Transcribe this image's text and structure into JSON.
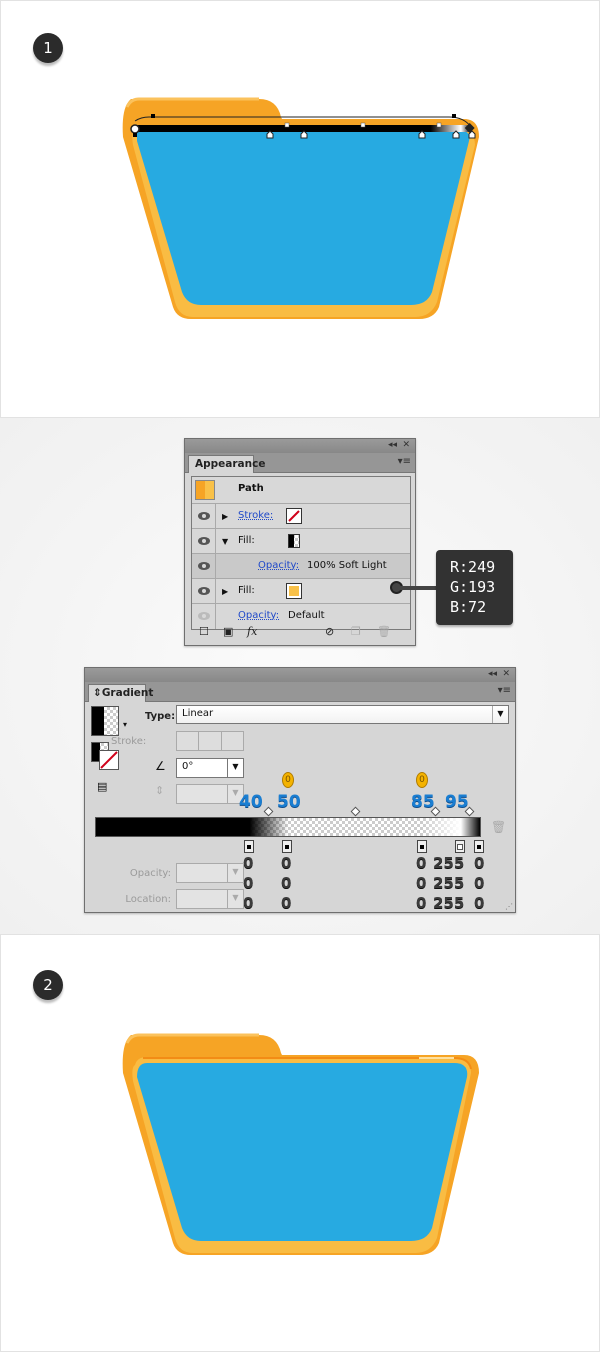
{
  "steps": [
    {
      "number": "1"
    },
    {
      "number": "2"
    }
  ],
  "appearance_panel": {
    "tab_label": "Appearance",
    "collapse_icon": "double-chevron-left-icon",
    "close_icon": "close-icon",
    "menu_icon": "panel-menu-icon",
    "object_label": "Path",
    "rows": [
      {
        "visible": true,
        "expanded": false,
        "label": "Stroke:",
        "swatch": "none"
      },
      {
        "visible": true,
        "expanded": true,
        "label": "Fill:",
        "swatch": "gradient"
      },
      {
        "visible": true,
        "label": "Opacity:",
        "value": "100% Soft Light"
      },
      {
        "visible": true,
        "expanded": false,
        "label": "Fill:",
        "swatch": "#F9C148"
      },
      {
        "visible": false,
        "label": "Opacity:",
        "value": "Default"
      }
    ],
    "footer_icons": [
      "add-new-stroke-icon",
      "add-new-fill-icon",
      "fx-icon",
      "clear-appearance-icon",
      "duplicate-item-icon",
      "delete-item-icon"
    ],
    "fx_label": "fx"
  },
  "color_tooltip": {
    "r": "R:249",
    "g": "G:193",
    "b": "B:72"
  },
  "gradient_panel": {
    "tab_label": "Gradient",
    "type_label": "Type:",
    "type_value": "Linear",
    "stroke_label": "Stroke:",
    "angle_value": "0°",
    "opacity_label": "Opacity:",
    "location_label": "Location:",
    "stops": [
      {
        "location": "40",
        "r": "0",
        "g": "0",
        "b": "0",
        "opacity": "100"
      },
      {
        "location": "50",
        "r": "0",
        "g": "0",
        "b": "0",
        "opacity": "0"
      },
      {
        "location": "85",
        "r": "0",
        "g": "0",
        "b": "0",
        "opacity": "0"
      },
      {
        "location": "95",
        "r": "255",
        "g": "255",
        "b": "255",
        "opacity": "100"
      },
      {
        "location": "100",
        "r": "0",
        "g": "0",
        "b": "0",
        "opacity": "100"
      }
    ],
    "opacity_annotations": [
      "0",
      "0"
    ]
  },
  "colors": {
    "folder_orange": "#F6A425",
    "folder_yellow": "#F9C148",
    "folder_blue": "#27AAE1"
  }
}
